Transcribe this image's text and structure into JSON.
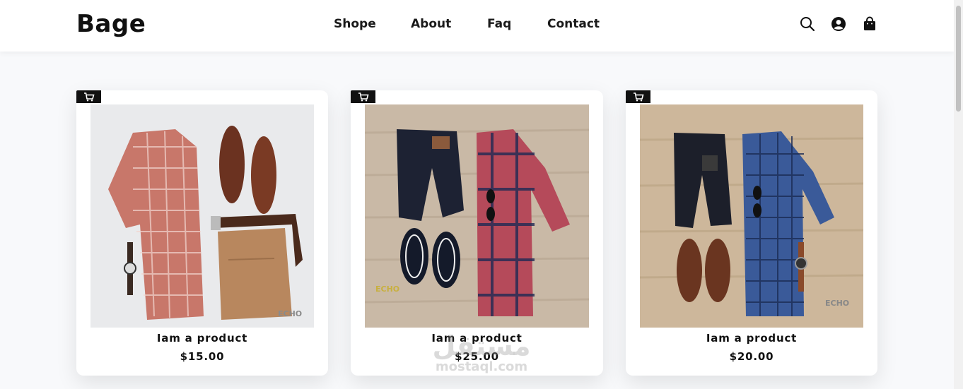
{
  "brand": {
    "logo": "Bage"
  },
  "nav": {
    "links": [
      "Shope",
      "About",
      "Faq",
      "Contact"
    ],
    "icons": [
      "search-icon",
      "account-icon",
      "shopping-bag-icon"
    ]
  },
  "products": [
    {
      "title": "Iam a product",
      "price": "$15.00",
      "image": "outfit-red-checked-shirt-khaki-pants",
      "cart_icon": "cart-icon"
    },
    {
      "title": "Iam a product",
      "price": "$25.00",
      "image": "outfit-navy-jeans-plaid-shirt",
      "cart_icon": "cart-icon"
    },
    {
      "title": "Iam a product",
      "price": "$20.00",
      "image": "outfit-dark-jeans-blue-gingham-shirt",
      "cart_icon": "cart-icon"
    }
  ],
  "watermark": {
    "arabic": "مستقل",
    "latin": "mostaql.com"
  },
  "colors": {
    "accent": "#111111",
    "background": "#f8f9fb",
    "card": "#ffffff"
  }
}
